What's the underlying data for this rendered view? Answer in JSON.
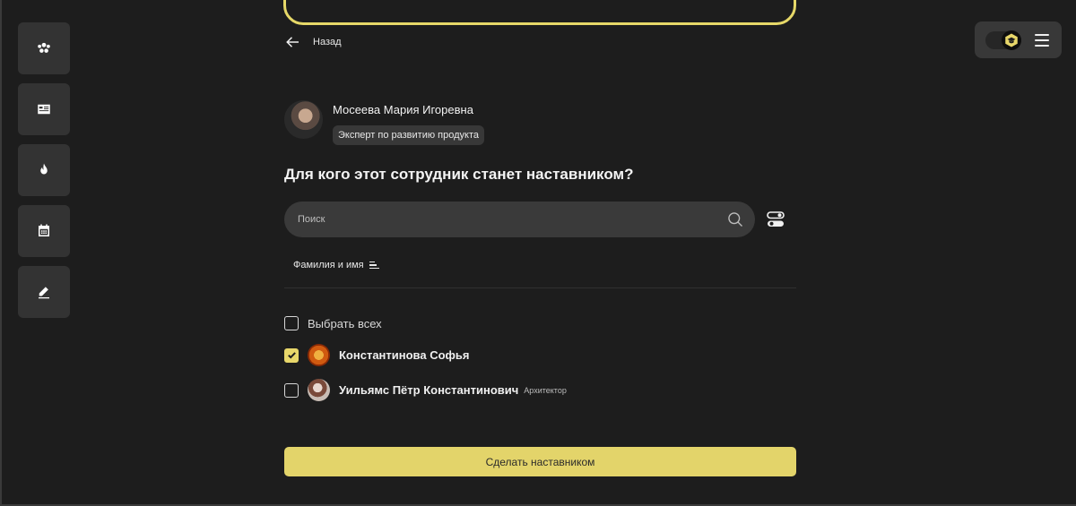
{
  "sidebar": {
    "items": [
      {
        "icon": "team-icon"
      },
      {
        "icon": "news-icon"
      },
      {
        "icon": "fire-icon"
      },
      {
        "icon": "calendar-icon"
      },
      {
        "icon": "edit-icon"
      }
    ]
  },
  "header": {
    "back_label": "Назад"
  },
  "profile": {
    "name": "Мосеева Мария Игоревна",
    "role": "Эксперт по развитию продукта"
  },
  "question": "Для кого этот сотрудник станет наставником?",
  "search": {
    "placeholder": "Поиск",
    "value": ""
  },
  "sort": {
    "label": "Фамилия и имя"
  },
  "list": {
    "select_all_label": "Выбрать всех",
    "select_all_checked": false,
    "people": [
      {
        "name": "Константинова Софья",
        "role": "",
        "checked": true
      },
      {
        "name": "Уильямс Пётр Константинович",
        "role": "Архитектор",
        "checked": false
      }
    ]
  },
  "action": {
    "submit_label": "Сделать наставником"
  },
  "colors": {
    "background": "#1d1d1d",
    "accent": "#e3d46a",
    "surface": "#333333"
  }
}
